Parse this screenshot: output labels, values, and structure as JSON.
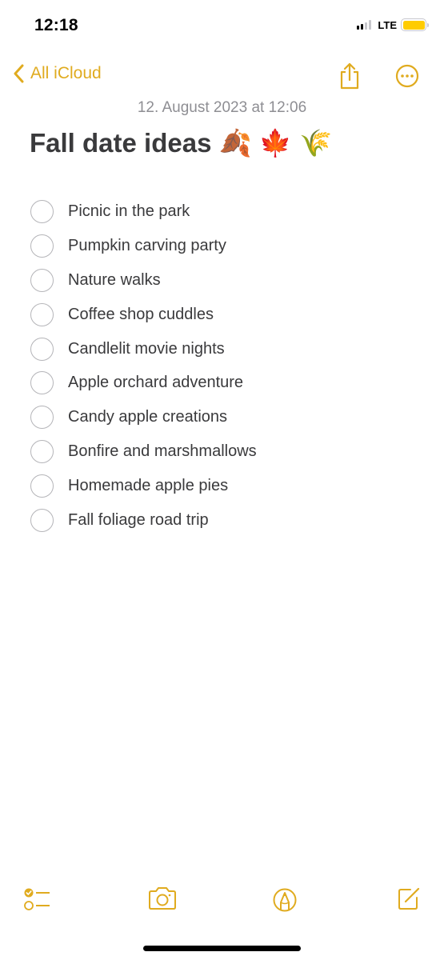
{
  "status_bar": {
    "time": "12:18",
    "network": "LTE",
    "signal_bars_active": 2,
    "signal_bars_total": 4,
    "battery_color": "#ffcc00"
  },
  "nav": {
    "back_label": "All iCloud",
    "back_icon": "chevron-left-icon",
    "share_icon": "share-icon",
    "more_icon": "ellipsis-circle-icon",
    "accent_color": "#e0ab1f"
  },
  "note": {
    "date": "12. August 2023 at 12:06",
    "title": "Fall date ideas 🍂 🍁 🌾",
    "checklist": [
      {
        "label": "Picnic in the park",
        "checked": false
      },
      {
        "label": "Pumpkin carving party",
        "checked": false
      },
      {
        "label": "Nature walks",
        "checked": false
      },
      {
        "label": "Coffee shop cuddles",
        "checked": false
      },
      {
        "label": "Candlelit movie nights",
        "checked": false
      },
      {
        "label": "Apple orchard adventure",
        "checked": false
      },
      {
        "label": "Candy apple creations",
        "checked": false
      },
      {
        "label": "Bonfire and marshmallows",
        "checked": false
      },
      {
        "label": "Homemade apple pies",
        "checked": false
      },
      {
        "label": "Fall foliage road trip",
        "checked": false
      }
    ]
  },
  "toolbar": {
    "items": [
      "checklist-icon",
      "camera-icon",
      "markup-icon",
      "compose-icon"
    ]
  }
}
